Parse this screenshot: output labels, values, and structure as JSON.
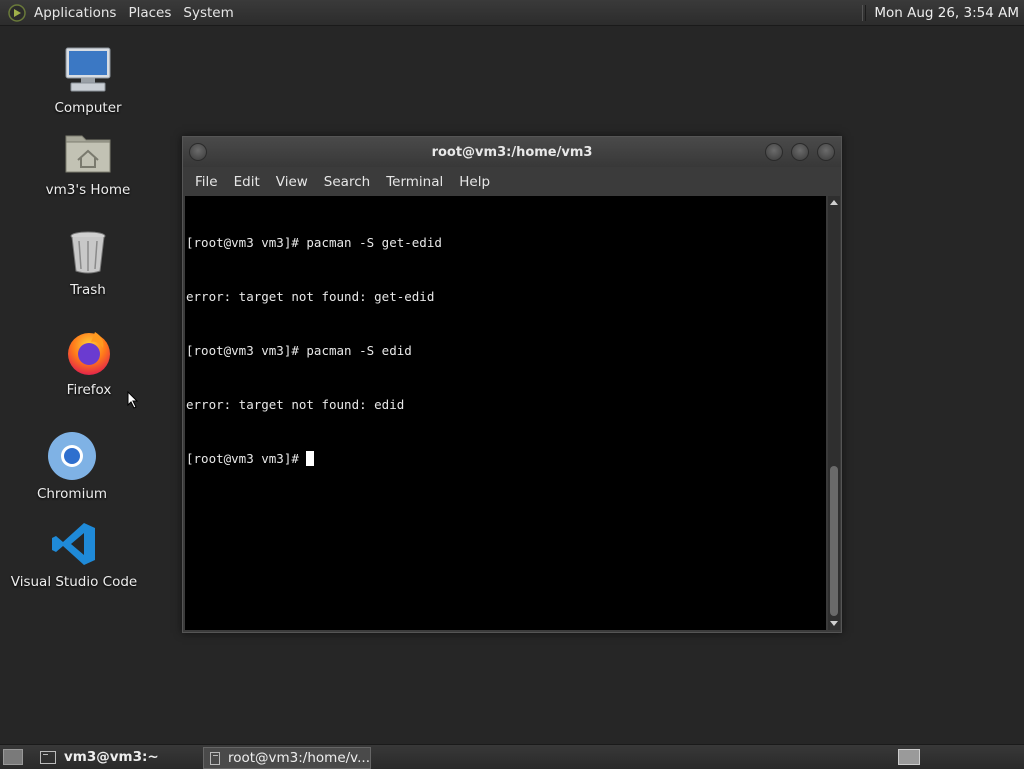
{
  "top_panel": {
    "menus": [
      "Applications",
      "Places",
      "System"
    ],
    "clock": "Mon Aug 26,  3:54 AM"
  },
  "desktop_icons": [
    {
      "label": "Computer",
      "icon": "computer-icon"
    },
    {
      "label": "vm3's Home",
      "icon": "home-folder-icon"
    },
    {
      "label": "Trash",
      "icon": "trash-icon"
    },
    {
      "label": "Firefox",
      "icon": "firefox-icon"
    },
    {
      "label": "Chromium",
      "icon": "chromium-icon"
    },
    {
      "label": "Visual Studio Code",
      "icon": "vscode-icon"
    }
  ],
  "terminal": {
    "title": "root@vm3:/home/vm3",
    "menu": [
      "File",
      "Edit",
      "View",
      "Search",
      "Terminal",
      "Help"
    ],
    "lines": [
      "[root@vm3 vm3]# pacman -S get-edid",
      "error: target not found: get-edid",
      "[root@vm3 vm3]# pacman -S edid",
      "error: target not found: edid"
    ],
    "prompt": "[root@vm3 vm3]# "
  },
  "taskbar": {
    "tasks": [
      "vm3@vm3:~",
      "root@vm3:/home/v..."
    ]
  }
}
